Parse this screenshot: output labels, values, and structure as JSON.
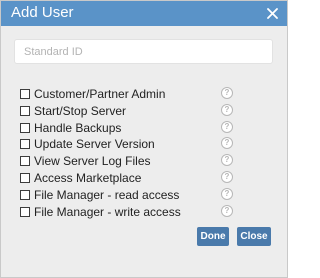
{
  "dialog": {
    "title": "Add User",
    "close_icon": "close-x-icon"
  },
  "standard_id": {
    "placeholder": "Standard ID",
    "value": ""
  },
  "permissions": [
    {
      "label": "Customer/Partner Admin",
      "checked": false
    },
    {
      "label": "Start/Stop Server",
      "checked": false
    },
    {
      "label": "Handle Backups",
      "checked": false
    },
    {
      "label": "Update Server Version",
      "checked": false
    },
    {
      "label": "View Server Log Files",
      "checked": false
    },
    {
      "label": "Access Marketplace",
      "checked": false
    },
    {
      "label": "File Manager - read access",
      "checked": false
    },
    {
      "label": "File Manager - write access",
      "checked": false
    }
  ],
  "help_glyph": "?",
  "buttons": {
    "done": "Done",
    "close": "Close"
  },
  "colors": {
    "titlebar": "#5a93c8",
    "button": "#4a7aab",
    "dialog_bg": "#ededed"
  }
}
